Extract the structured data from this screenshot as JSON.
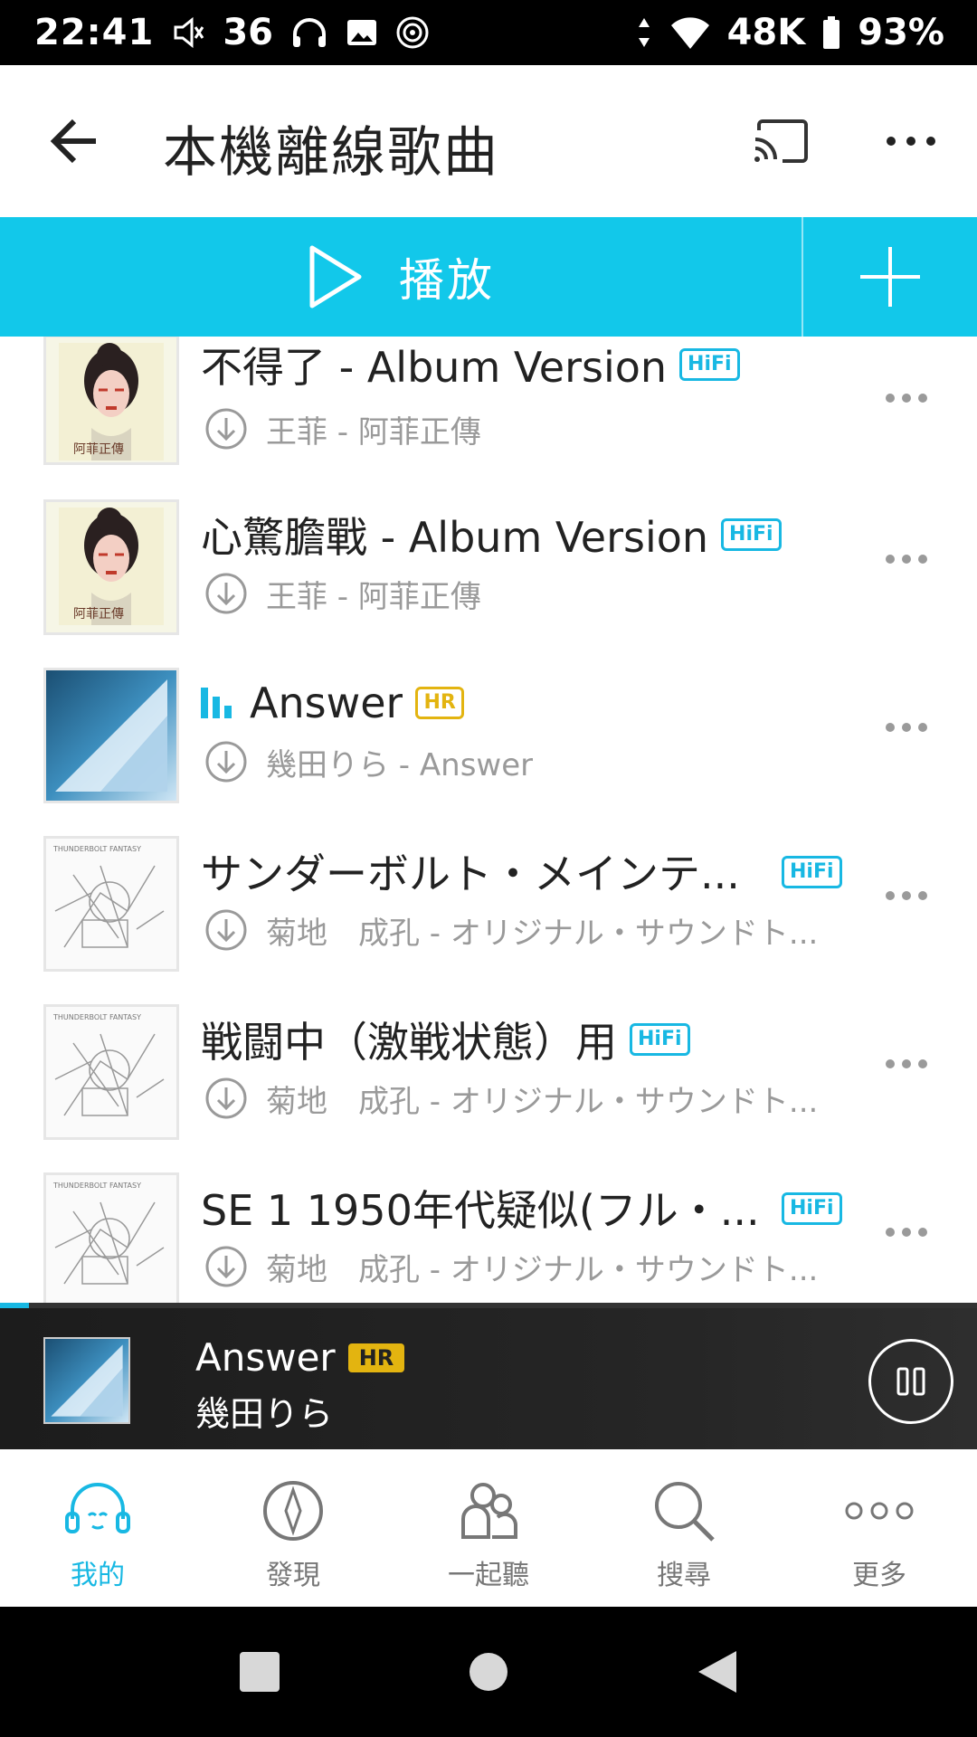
{
  "status_bar": {
    "time": "22:41",
    "volume_level": "36",
    "network_speed": "48K",
    "battery": "93%",
    "icons": [
      "volume-icon",
      "headphones-icon",
      "image-icon",
      "cast-target-icon",
      "data-arrows-icon",
      "wifi-icon",
      "battery-icon"
    ]
  },
  "app_bar": {
    "title": "本機離線歌曲",
    "icons": [
      "back-arrow-icon",
      "cast-icon",
      "more-horizontal-icon"
    ]
  },
  "play_bar": {
    "play_label": "播放",
    "accent_color": "#12c8ea"
  },
  "songs": [
    {
      "title": "不得了 - Album Version",
      "badge": "HiFi",
      "subtitle": "王菲 - 阿菲正傳",
      "cover": "faye-wong-cover",
      "playing": false
    },
    {
      "title": "心驚膽戰 - Album Version",
      "badge": "HiFi",
      "subtitle": "王菲 - 阿菲正傳",
      "cover": "faye-wong-cover",
      "playing": false
    },
    {
      "title": "Answer",
      "badge": "HR",
      "subtitle": "幾田りら - Answer",
      "cover": "answer-cover",
      "playing": true
    },
    {
      "title": "サンダーボルト・メインテ...",
      "badge": "HiFi",
      "subtitle": "菊地　成孔 - オリジナル・サウンドト...",
      "cover": "sketch-cover",
      "playing": false
    },
    {
      "title": "戦闘中（激戦状態）用",
      "badge": "HiFi",
      "subtitle": "菊地　成孔 - オリジナル・サウンドト...",
      "cover": "sketch-cover",
      "playing": false
    },
    {
      "title": "SE 1 1950年代疑似(フル・...",
      "badge": "HiFi",
      "subtitle": "菊地　成孔 - オリジナル・サウンドト...",
      "cover": "sketch-cover",
      "playing": false
    }
  ],
  "now_playing": {
    "title": "Answer",
    "badge": "HR",
    "artist": "幾田りら",
    "progress": 0.03
  },
  "bottom_nav": {
    "items": [
      {
        "label": "我的",
        "icon": "headphones-face-icon",
        "active": true
      },
      {
        "label": "發現",
        "icon": "compass-icon",
        "active": false
      },
      {
        "label": "一起聽",
        "icon": "people-icon",
        "active": false
      },
      {
        "label": "搜尋",
        "icon": "search-icon",
        "active": false
      },
      {
        "label": "更多",
        "icon": "three-circles-icon",
        "active": false
      }
    ]
  },
  "colors": {
    "accent": "#12c8ea",
    "hifi": "#18b8e3",
    "hr": "#e3b410"
  }
}
